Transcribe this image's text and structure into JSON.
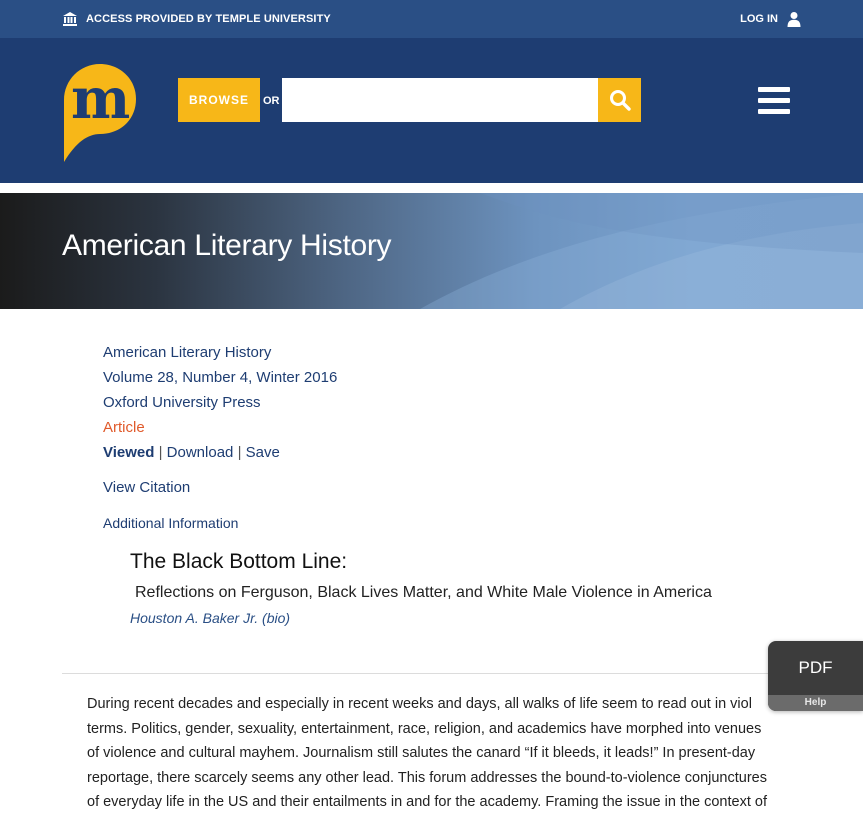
{
  "access_bar": {
    "access_text": "ACCESS PROVIDED BY TEMPLE UNIVERSITY",
    "login_label": "LOG IN"
  },
  "header": {
    "browse_label": "BROWSE",
    "or_label": "OR",
    "search_value": "",
    "colors": {
      "brand_blue": "#1e3d72",
      "accent_yellow": "#f7b718"
    }
  },
  "banner": {
    "title": "American Literary History"
  },
  "meta": {
    "journal": "American Literary History",
    "issue": "Volume 28, Number 4, Winter 2016",
    "publisher": "Oxford University Press",
    "type": "Article",
    "viewed": "Viewed",
    "sep1": "|",
    "download": "Download",
    "sep2": "|",
    "save": "Save",
    "view_citation": "View Citation",
    "additional_info": "Additional Information"
  },
  "article": {
    "title": "The Black Bottom Line:",
    "subtitle": "Reflections on Ferguson, Black Lives Matter, and White Male Violence in America",
    "author": "Houston A. Baker Jr.",
    "bio": "(bio)",
    "body_lines": [
      "During recent decades and especially in recent weeks and days, all walks of life seem to read out in viol",
      "terms. Politics, gender, sexuality, entertainment, race, religion, and academics have morphed into venues",
      "of violence and cultural mayhem. Journalism still salutes the canard “If it bleeds, it leads!” In present-day",
      "reportage, there scarcely seems any other lead. This forum addresses the bound-to-violence conjunctures",
      "of everyday life in the US and their entailments in and for the academy. Framing the issue in the context of"
    ]
  },
  "pdf_widget": {
    "label": "PDF",
    "help": "Help"
  }
}
